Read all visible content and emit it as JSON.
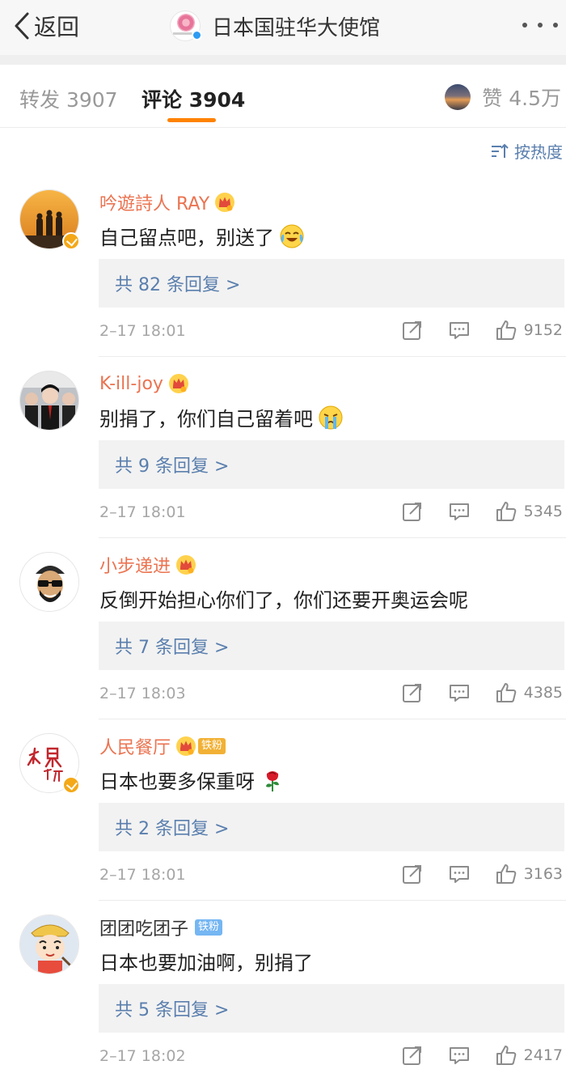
{
  "nav": {
    "back_label": "返回",
    "title": "日本国驻华大使馆"
  },
  "tabs": {
    "repost": "转发 3907",
    "comment": "评论 3904",
    "like": "赞 4.5万"
  },
  "sort": {
    "label": "按热度"
  },
  "comments": [
    {
      "name": "吟遊詩人 RAY",
      "text": "自己留点吧，别送了",
      "replies": "共 82 条回复 >",
      "time": "2–17 18:01",
      "likes": "9152",
      "emoji": "laugh-cry"
    },
    {
      "name": "K-ill-joy",
      "text": "别捐了，你们自己留着吧",
      "replies": "共 9 条回复 >",
      "time": "2–17 18:01",
      "likes": "5345",
      "emoji": "crying"
    },
    {
      "name": "小步递进",
      "text": "反倒开始担心你们了，你们还要开奥运会呢",
      "replies": "共 7 条回复 >",
      "time": "2–17 18:03",
      "likes": "4385",
      "emoji": ""
    },
    {
      "name": "人民餐厅",
      "fan_badge": "铁粉",
      "text": "日本也要多保重呀",
      "replies": "共 2 条回复 >",
      "time": "2–17 18:01",
      "likes": "3163",
      "emoji": "rose"
    },
    {
      "name": "团团吃团子",
      "fan_badge": "铁粉",
      "text": "日本也要加油啊，别捐了",
      "replies": "共 5 条回复 >",
      "time": "2–17 18:02",
      "likes": "2417",
      "emoji": ""
    }
  ],
  "colors": {
    "accent": "#ff8200",
    "username": "#eb7350",
    "link": "#5a7fae",
    "meta": "#a6a6a6"
  }
}
